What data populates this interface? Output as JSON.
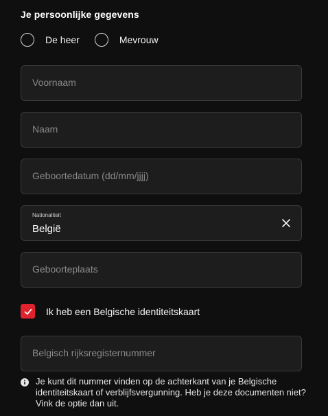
{
  "section": {
    "title": "Je persoonlijke gegevens"
  },
  "gender": {
    "options": [
      {
        "label": "De heer",
        "selected": false
      },
      {
        "label": "Mevrouw",
        "selected": false
      }
    ]
  },
  "fields": {
    "first_name": {
      "placeholder": "Voornaam",
      "value": ""
    },
    "last_name": {
      "placeholder": "Naam",
      "value": ""
    },
    "birth_date": {
      "placeholder": "Geboortedatum (dd/mm/jjjj)",
      "value": ""
    },
    "nationality": {
      "label": "Nationaliteit",
      "value": "België",
      "clear_icon": "close-icon"
    },
    "birth_place": {
      "placeholder": "Geboorteplaats",
      "value": ""
    },
    "national_number": {
      "placeholder": "Belgisch rijksregisternummer",
      "value": ""
    }
  },
  "id_card": {
    "label": "Ik heb een Belgische identiteitskaart",
    "checked": true
  },
  "info": {
    "icon": "info-icon",
    "text": "Je kunt dit nummer vinden op de achterkant van je Belgische identiteitskaart of verblijfsvergunning. Heb je deze documenten niet? Vink de optie dan uit."
  },
  "colors": {
    "background": "#0f0f0f",
    "field_background": "#1d1d1d",
    "field_border": "#3a3a3a",
    "accent": "#e0222e",
    "placeholder": "#8a8a8a"
  }
}
